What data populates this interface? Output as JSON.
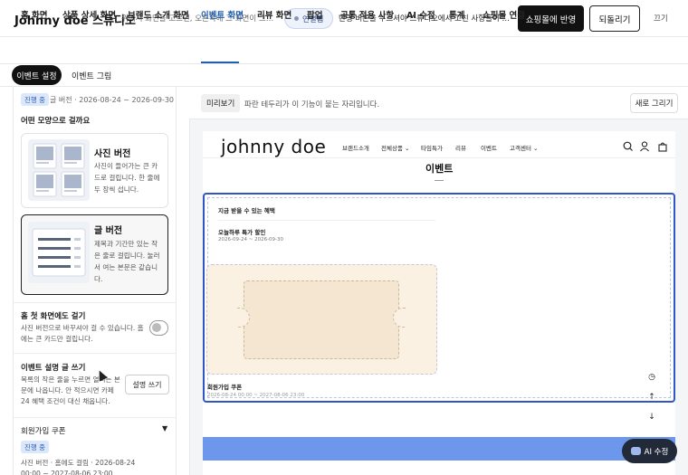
{
  "topbar": {
    "app_title": "Johnny doe 스튜디오",
    "hint_left": "위에서 화면을 고르면, 오른쪽에 그 화면이 그대로 …",
    "connection_label": "연결됨",
    "hint_right": "반영 버튼을 누르셔야 스튜디오에서 고친 사항들이 실제로 …",
    "publish_label": "쇼핑몰에 반영",
    "revert_label": "되돌리기",
    "close_label": "끄기"
  },
  "nav_tabs": [
    {
      "label": "홈 화면"
    },
    {
      "label": "상품 상세 화면"
    },
    {
      "label": "브랜드 소개 화면"
    },
    {
      "label": "이벤트 화면"
    },
    {
      "label": "리뷰 화면"
    },
    {
      "label": "팝업"
    },
    {
      "label": "공통 적용 사항"
    },
    {
      "label": "AI 수정"
    },
    {
      "label": "통계"
    },
    {
      "label": "쇼핑몰 연결"
    }
  ],
  "active_nav_index": 3,
  "sub_tabs": {
    "settings": "이벤트 설정",
    "drawing": "이벤트 그림"
  },
  "left": {
    "status_badge": "진행 중",
    "status_line": "글 버전 · 2026-08-24 ~ 2026-09-30",
    "shape_heading": "어떤 모양으로 걸까요",
    "card_photo": {
      "title": "사진 버전",
      "desc": "사진이 들어가는 큰 카드로 걸립니다. 한 줄에 두 장씩 섭니다."
    },
    "card_text": {
      "title": "글 버전",
      "desc": "제목과 기간만 있는 작은 줄로 걸립니다. 눌러서 여는 본문은 같습니다."
    },
    "home_toggle": {
      "title": "홈 첫 화면에도 걸기",
      "desc": "사진 버전으로 바꾸셔야 걸 수 있습니다. 홈에는 큰 카드만 걸립니다."
    },
    "note": {
      "title": "이벤트 설명 글 쓰기",
      "desc": "목록의 작은 줄을 누르면 열리는 본문에 나옵니다. 안 적으시면 카페24 혜택 조건이 대신 채웁니다.",
      "button": "설명 쓰기"
    },
    "coupon": {
      "title": "회원가입 쿠폰",
      "caret": "▼",
      "badge": "진행 중",
      "meta": "사진 버전 · 홈에도 걸림 · 2026-08-24 00:00 ~ 2027-08-06 23:00"
    }
  },
  "preview": {
    "label": "미리보기",
    "hint": "파란 테두리가 이 기능이 붙는 자리입니다.",
    "redraw": "새로 그리기"
  },
  "site": {
    "logo": "johnny  doe",
    "nav": [
      "브랜드소개",
      "전체상품 ⌄",
      "타임특가",
      "리뷰",
      "이벤트",
      "고객센터 ⌄"
    ],
    "page_title": "이벤트",
    "benefit_heading": "지금 받을 수 있는 혜택",
    "sale_title": "오늘하루 특가 할인",
    "sale_dates": "2026-09-24 ~ 2026-09-30",
    "signup_title": "회원가입 쿠폰",
    "signup_dates": "2026-08-24 00:00 ~ 2027-08-06 23:00"
  },
  "controls": {
    "history_icon": "◷",
    "up_icon": "↑",
    "down_icon": "↓"
  },
  "ai_fab": {
    "label": "AI 수정"
  },
  "colors": {
    "accent": "#1f5fb0",
    "highlight": "#2f56c4",
    "strip": "#6d97ec"
  }
}
